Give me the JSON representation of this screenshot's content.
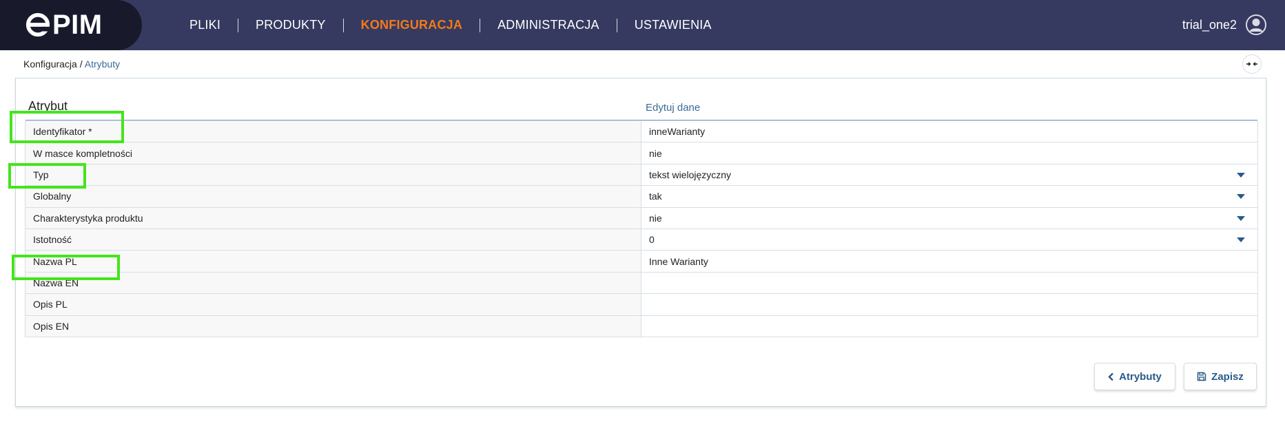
{
  "app": {
    "logo_text": "PIM"
  },
  "nav": {
    "items": [
      {
        "label": "PLIKI",
        "active": false
      },
      {
        "label": "PRODUKTY",
        "active": false
      },
      {
        "label": "KONFIGURACJA",
        "active": true
      },
      {
        "label": "ADMINISTRACJA",
        "active": false
      },
      {
        "label": "USTAWIENIA",
        "active": false
      }
    ],
    "active_color": "#f27a1a"
  },
  "user": {
    "name": "trial_one2"
  },
  "breadcrumb": {
    "root": "Konfiguracja",
    "separator": " / ",
    "current": "Atrybuty"
  },
  "panel": {
    "title": "Atrybut",
    "edit_link": "Edytuj dane",
    "rows": [
      {
        "label": "Identyfikator *",
        "value": "inneWarianty",
        "dropdown": false
      },
      {
        "label": "W masce kompletności",
        "value": "nie",
        "dropdown": false
      },
      {
        "label": "Typ",
        "value": "tekst wielojęzyczny",
        "dropdown": true
      },
      {
        "label": "Globalny",
        "value": "tak",
        "dropdown": true
      },
      {
        "label": "Charakterystyka produktu",
        "value": "nie",
        "dropdown": true
      },
      {
        "label": "Istotność",
        "value": "0",
        "dropdown": true
      },
      {
        "label": "Nazwa PL",
        "value": "Inne Warianty",
        "dropdown": false
      },
      {
        "label": "Nazwa EN",
        "value": "",
        "dropdown": false
      },
      {
        "label": "Opis PL",
        "value": "",
        "dropdown": false
      },
      {
        "label": "Opis EN",
        "value": "",
        "dropdown": false
      }
    ]
  },
  "buttons": {
    "back_label": "Atrybuty",
    "save_label": "Zapisz"
  },
  "colors": {
    "topbar": "#363a60",
    "logo_tab": "#181a2c",
    "link": "#3a6a9a",
    "highlight": "#43e51a"
  }
}
